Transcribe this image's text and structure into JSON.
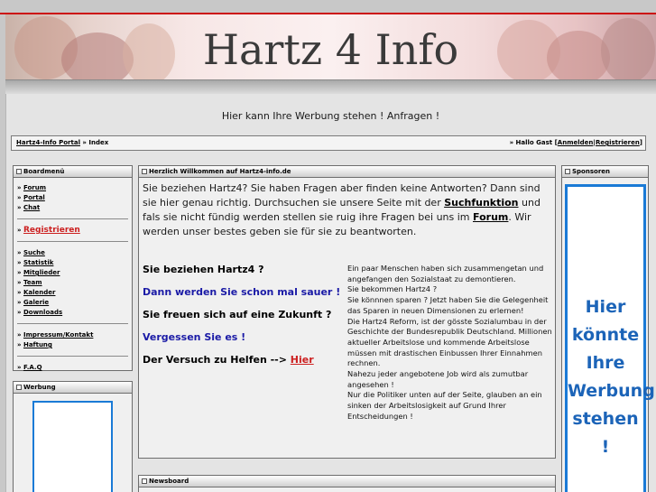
{
  "header": {
    "site_title": "Hartz 4 Info"
  },
  "ad_line": "Hier kann Ihre Werbung stehen ! Anfragen !",
  "breadcrumb": {
    "home_link": "Hartz4-Info Portal",
    "separator": " » ",
    "current": "Index",
    "greeting_prefix": "» Hallo Gast [",
    "login": "Anmelden",
    "pipe": "|",
    "register": "Registrieren",
    "greeting_suffix": "]"
  },
  "boardmenu": {
    "title": "Boardmenü",
    "group1": [
      "Forum",
      "Portal",
      "Chat"
    ],
    "register": "Registrieren",
    "group2": [
      "Suche",
      "Statistik",
      "Mitglieder",
      "Team",
      "Kalender",
      "Galerie",
      "Downloads"
    ],
    "group3": [
      "Impressum/Kontakt",
      "Haftung"
    ],
    "group4": [
      "F.A.Q"
    ],
    "bullet": "» "
  },
  "werbung": {
    "title": "Werbung"
  },
  "welcome": {
    "title": "Herzlich Willkommen auf Hartz4-info.de",
    "intro_a": "Sie beziehen Hartz4? Sie haben Fragen aber finden keine Antworten? Dann sind sie hier genau richtig. Durchsuchen sie unsere Seite mit der ",
    "search_link": "Suchfunktion",
    "intro_b": " und fals sie nicht fündig werden stellen sie ruig ihre Fragen bei uns im ",
    "forum_link": "Forum",
    "intro_c": ". Wir werden unser bestes geben sie für sie zu beantworten.",
    "left_lines": [
      "Sie beziehen Hartz4 ?",
      "Dann werden Sie schon mal sauer !",
      "Sie freuen sich auf eine Zukunft ?",
      "Vergessen Sie es !",
      "Der Versuch zu Helfen --> "
    ],
    "hier_link": "Hier",
    "right_text": [
      "Ein paar Menschen haben sich zusammengetan und angefangen den Sozialstaat zu demontieren.",
      "Sie bekommen Hartz4 ?",
      "Sie könnnen sparen ? Jetzt haben Sie die Gelegenheit das Sparen in neuen Dimensionen zu erlernen!",
      "Die Hartz4 Reform, ist der gösste Sozialumbau in der Geschichte der Bundesrepublik Deutschland. Millionen aktueller Arbeitslose und kommende Arbeitslose müssen mit drastischen Einbussen Ihrer Einnahmen rechnen.",
      "Nahezu jeder angebotene Job wird als zumutbar angesehen !",
      "Nur die Politiker unten auf der Seite, glauben an ein sinken der Arbeitslosigkeit auf Grund Ihrer Entscheidungen !"
    ]
  },
  "newsboard": {
    "title": "Newsboard"
  },
  "sponsoren": {
    "title": "Sponsoren",
    "ad_words": [
      "Hier",
      "könnte",
      "Ihre",
      "Werbung",
      "stehen",
      "!"
    ]
  },
  "colors": {
    "accent_red": "#cc2020",
    "ad_blue": "#1a7ad6",
    "link_blue": "#1a1aa6"
  }
}
